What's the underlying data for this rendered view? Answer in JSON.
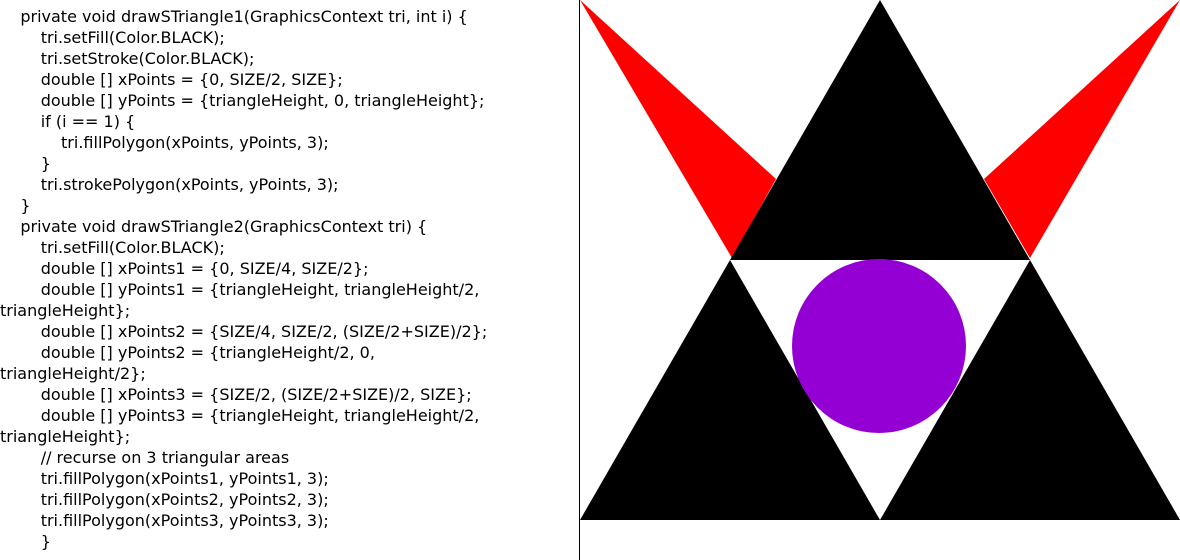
{
  "code_lines": [
    "    private void drawSTriangle1(GraphicsContext tri, int i) {",
    "        tri.setFill(Color.BLACK);",
    "        tri.setStroke(Color.BLACK);",
    "        double [] xPoints = {0, SIZE/2, SIZE};",
    "        double [] yPoints = {triangleHeight, 0, triangleHeight};",
    "        if (i == 1) {",
    "            tri.fillPolygon(xPoints, yPoints, 3);",
    "        }",
    "        tri.strokePolygon(xPoints, yPoints, 3);",
    "    }",
    "    private void drawSTriangle2(GraphicsContext tri) {",
    "        tri.setFill(Color.BLACK);",
    "        double [] xPoints1 = {0, SIZE/4, SIZE/2};",
    "        double [] yPoints1 = {triangleHeight, triangleHeight/2,",
    "triangleHeight};",
    "        double [] xPoints2 = {SIZE/4, SIZE/2, (SIZE/2+SIZE)/2};",
    "        double [] yPoints2 = {triangleHeight/2, 0,",
    "triangleHeight/2};",
    "        double [] xPoints3 = {SIZE/2, (SIZE/2+SIZE)/2, SIZE};",
    "        double [] yPoints3 = {triangleHeight, triangleHeight/2,",
    "triangleHeight};",
    "        // recurse on 3 triangular areas",
    "        tri.fillPolygon(xPoints1, yPoints1, 3);",
    "        tri.fillPolygon(xPoints2, yPoints2, 3);",
    "        tri.fillPolygon(xPoints3, yPoints3, 3);",
    "        }"
  ],
  "colors": {
    "black": "#000000",
    "red": "#ff0000",
    "purple": "#9400d3",
    "white": "#ffffff",
    "divider": "#000000"
  }
}
